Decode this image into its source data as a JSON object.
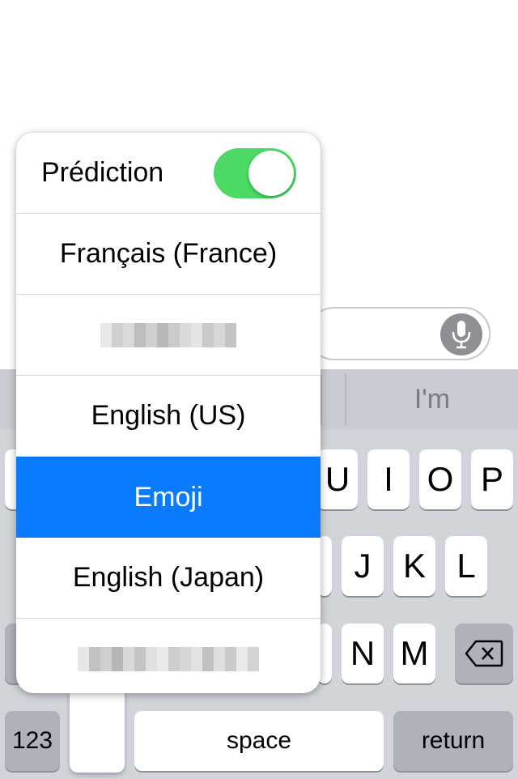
{
  "message_field": {
    "mic_icon": "microphone-icon"
  },
  "predictions": {
    "word_right": "I'm"
  },
  "keyboard": {
    "row1": [
      "U",
      "I",
      "O",
      "P"
    ],
    "row2": [
      "J",
      "K",
      "L"
    ],
    "row3": [
      "N",
      "M"
    ],
    "numbers_label": "123",
    "space_label": "space",
    "return_label": "return",
    "delete_icon": "backspace-icon"
  },
  "language_menu": {
    "prediction_label": "Prédiction",
    "prediction_enabled": true,
    "items": [
      {
        "label": "Français (France)",
        "selected": false,
        "blurred": false
      },
      {
        "label": "",
        "selected": false,
        "blurred": true
      },
      {
        "label": "English (US)",
        "selected": false,
        "blurred": false
      },
      {
        "label": "Emoji",
        "selected": true,
        "blurred": false
      },
      {
        "label": "English (Japan)",
        "selected": false,
        "blurred": false
      },
      {
        "label": "",
        "selected": false,
        "blurred": true
      }
    ]
  },
  "colors": {
    "accent": "#0a7aff",
    "toggle_on": "#4cd964",
    "keyboard_bg": "#d1d4d9"
  }
}
